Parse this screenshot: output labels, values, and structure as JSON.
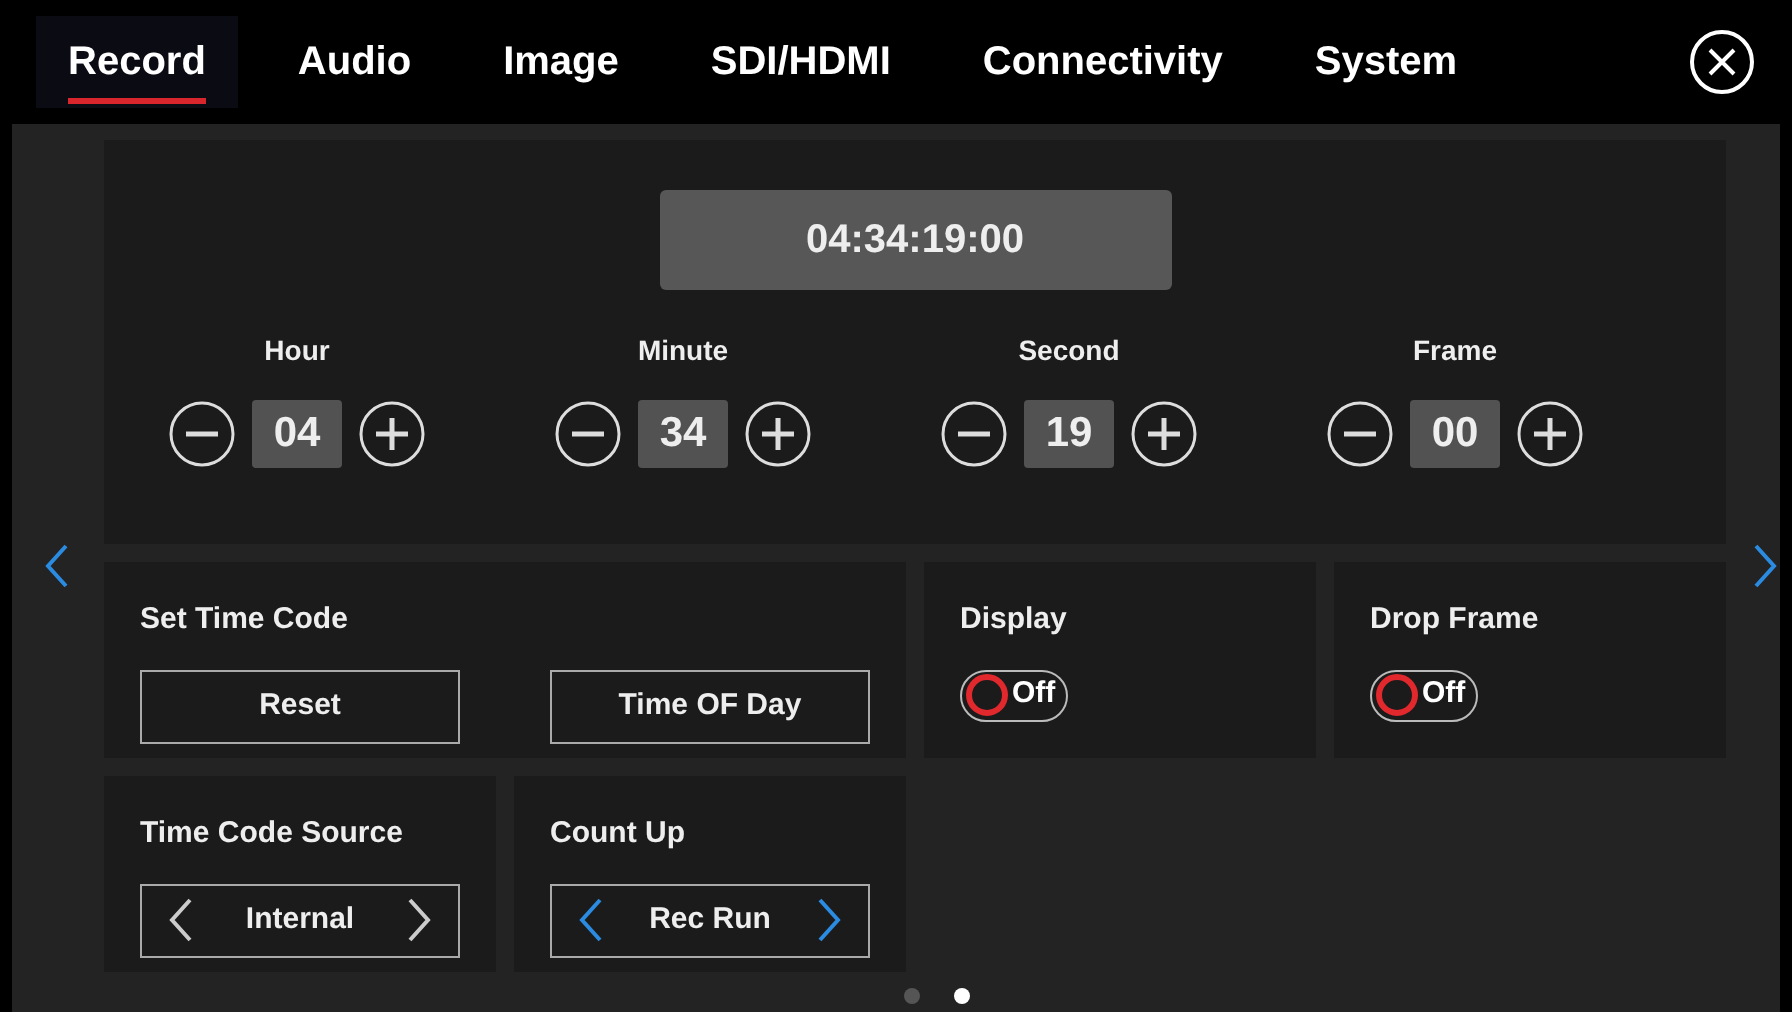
{
  "tabs": [
    {
      "label": "Record",
      "selected": true
    },
    {
      "label": "Audio",
      "selected": false
    },
    {
      "label": "Image",
      "selected": false
    },
    {
      "label": "SDI/HDMI",
      "selected": false
    },
    {
      "label": "Connectivity",
      "selected": false
    },
    {
      "label": "System",
      "selected": false
    }
  ],
  "timecode": "04:34:19:00",
  "fields": [
    {
      "label": "Hour",
      "value": "04"
    },
    {
      "label": "Minute",
      "value": "34"
    },
    {
      "label": "Second",
      "value": "19"
    },
    {
      "label": "Frame",
      "value": "00"
    }
  ],
  "set_time_code": {
    "label": "Set Time Code",
    "buttons": [
      "Reset",
      "Time OF Day"
    ]
  },
  "toggles": [
    {
      "label": "Display",
      "on": false,
      "text": "Off"
    },
    {
      "label": "Drop Frame",
      "on": false,
      "text": "Off"
    }
  ],
  "selectors": [
    {
      "label": "Time Code Source",
      "value": "Internal",
      "arrows_enabled": false
    },
    {
      "label": "Count Up",
      "value": "Rec Run",
      "arrows_enabled": true
    }
  ],
  "page_dots": [
    {
      "selected": false
    },
    {
      "selected": true
    }
  ]
}
